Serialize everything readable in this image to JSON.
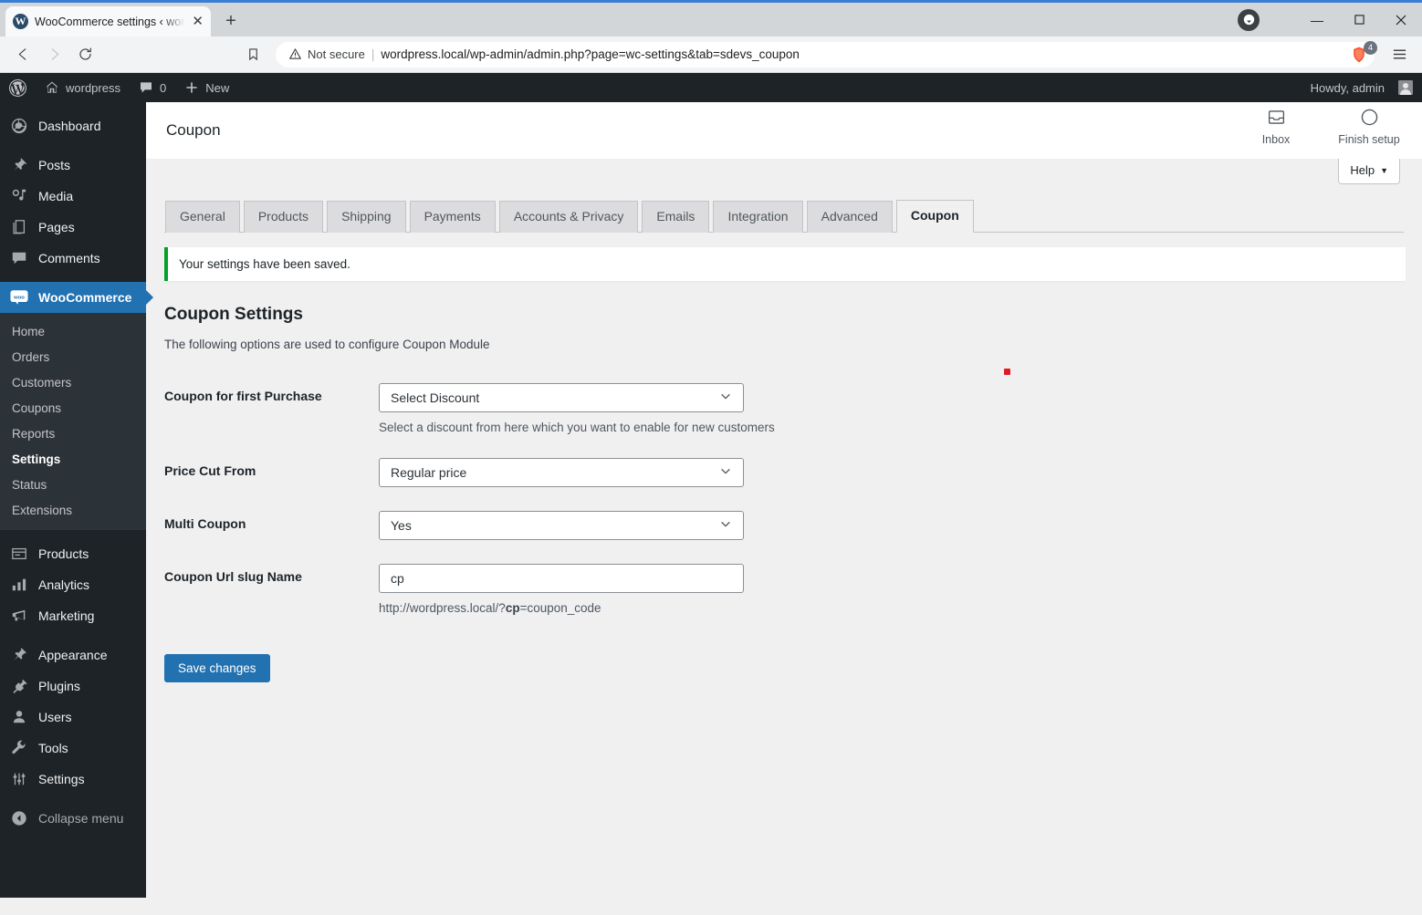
{
  "browser": {
    "tab": {
      "title": "WooCommerce settings ‹ wordpr",
      "favicon": "wordpress-icon",
      "close_label": "✕"
    },
    "new_tab_label": "+",
    "back_label": "◁",
    "forward_label": "▷",
    "reload_label": "⟳",
    "bookmark_label": "bookmark-icon",
    "security_label": "Not secure",
    "url": "wordpress.local/wp-admin/admin.php?page=wc-settings&tab=sdevs_coupon",
    "shield_badge": "4",
    "window": {
      "minimize": "—",
      "maximize": "▢",
      "close": "✕"
    }
  },
  "adminbar": {
    "logo": "wordpress-logo-icon",
    "site_name": "wordpress",
    "comment_count": "0",
    "new_label": "New",
    "howdy": "Howdy, admin"
  },
  "sidebar": {
    "items": [
      {
        "label": "Dashboard",
        "icon": "dashboard-icon",
        "name": "dashboard"
      },
      {
        "label": "Posts",
        "icon": "posts-icon",
        "name": "posts"
      },
      {
        "label": "Media",
        "icon": "media-icon",
        "name": "media"
      },
      {
        "label": "Pages",
        "icon": "pages-icon",
        "name": "pages"
      },
      {
        "label": "Comments",
        "icon": "comments-icon",
        "name": "comments"
      },
      {
        "label": "WooCommerce",
        "icon": "woocommerce-icon",
        "name": "woocommerce",
        "current": true
      },
      {
        "label": "Products",
        "icon": "products-icon",
        "name": "products"
      },
      {
        "label": "Analytics",
        "icon": "analytics-icon",
        "name": "analytics"
      },
      {
        "label": "Marketing",
        "icon": "marketing-icon",
        "name": "marketing"
      },
      {
        "label": "Appearance",
        "icon": "appearance-icon",
        "name": "appearance"
      },
      {
        "label": "Plugins",
        "icon": "plugins-icon",
        "name": "plugins"
      },
      {
        "label": "Users",
        "icon": "users-icon",
        "name": "users"
      },
      {
        "label": "Tools",
        "icon": "tools-icon",
        "name": "tools"
      },
      {
        "label": "Settings",
        "icon": "settings-icon",
        "name": "settings"
      }
    ],
    "submenu": [
      {
        "label": "Home",
        "name": "home"
      },
      {
        "label": "Orders",
        "name": "orders"
      },
      {
        "label": "Customers",
        "name": "customers"
      },
      {
        "label": "Coupons",
        "name": "coupons"
      },
      {
        "label": "Reports",
        "name": "reports"
      },
      {
        "label": "Settings",
        "name": "settings",
        "current": true
      },
      {
        "label": "Status",
        "name": "status"
      },
      {
        "label": "Extensions",
        "name": "extensions"
      }
    ],
    "collapse_label": "Collapse menu"
  },
  "header": {
    "title": "Coupon",
    "inbox_label": "Inbox",
    "inbox_icon": "inbox-icon",
    "finish_setup_label": "Finish setup",
    "finish_setup_icon": "circle-progress-icon",
    "help_label": "Help",
    "help_caret": "▼"
  },
  "tabs": [
    {
      "label": "General",
      "name": "general"
    },
    {
      "label": "Products",
      "name": "products"
    },
    {
      "label": "Shipping",
      "name": "shipping"
    },
    {
      "label": "Payments",
      "name": "payments"
    },
    {
      "label": "Accounts & Privacy",
      "name": "accounts-privacy"
    },
    {
      "label": "Emails",
      "name": "emails"
    },
    {
      "label": "Integration",
      "name": "integration"
    },
    {
      "label": "Advanced",
      "name": "advanced"
    },
    {
      "label": "Coupon",
      "name": "coupon",
      "active": true
    }
  ],
  "notice": {
    "text": "Your settings have been saved.",
    "accent_color": "#00a32a"
  },
  "main": {
    "section_title": "Coupon Settings",
    "section_desc": "The following options are used to configure Coupon Module",
    "fields": [
      {
        "label": "Coupon for first Purchase",
        "type": "select",
        "value": "Select Discount",
        "desc": "Select a discount from here which you want to enable for new customers",
        "name": "coupon-for-first-purchase"
      },
      {
        "label": "Price Cut From",
        "type": "select",
        "value": "Regular price",
        "desc": "",
        "name": "price-cut-from"
      },
      {
        "label": "Multi Coupon",
        "type": "select",
        "value": "Yes",
        "desc": "",
        "name": "multi-coupon"
      },
      {
        "label": "Coupon Url slug Name",
        "type": "text",
        "value": "cp",
        "desc_prefix": "http://wordpress.local/?",
        "desc_slug": "cp",
        "desc_suffix": "=coupon_code",
        "name": "coupon-url-slug-name"
      }
    ],
    "save_label": "Save changes"
  },
  "colors": {
    "wp_blue": "#2271b1",
    "admin_dark": "#1d2327",
    "submenu_dark": "#2c3338",
    "page_bg": "#f0f0f1",
    "success_green": "#00a32a",
    "brave_orange": "#fb542b",
    "cursor_red": "#e01b24"
  }
}
